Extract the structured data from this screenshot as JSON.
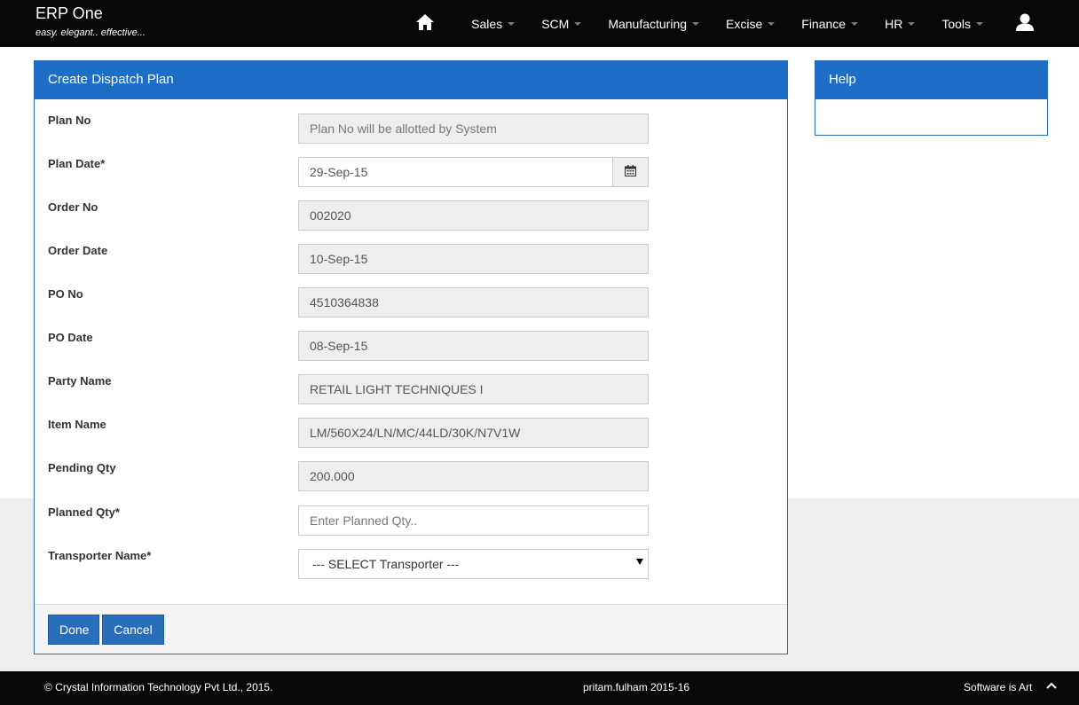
{
  "app": {
    "name": "ERP One",
    "tagline": "easy. elegant.. effective..."
  },
  "nav": {
    "items": [
      {
        "label": "Sales"
      },
      {
        "label": "SCM"
      },
      {
        "label": "Manufacturing"
      },
      {
        "label": "Excise"
      },
      {
        "label": "Finance"
      },
      {
        "label": "HR"
      },
      {
        "label": "Tools"
      }
    ],
    "icons": {
      "home": "home-icon",
      "user": "user-icon"
    }
  },
  "form": {
    "title": "Create Dispatch Plan",
    "fields": {
      "plan_no": {
        "label": "Plan No",
        "value": "",
        "placeholder": "Plan No will be allotted by System"
      },
      "plan_date": {
        "label": "Plan Date*",
        "value": "29-Sep-15"
      },
      "order_no": {
        "label": "Order No",
        "value": "002020"
      },
      "order_date": {
        "label": "Order Date",
        "value": "10-Sep-15"
      },
      "po_no": {
        "label": "PO No",
        "value": "4510364838"
      },
      "po_date": {
        "label": "PO Date",
        "value": "08-Sep-15"
      },
      "party_name": {
        "label": "Party Name",
        "value": "RETAIL LIGHT TECHNIQUES I"
      },
      "item_name": {
        "label": "Item Name",
        "value": "LM/560X24/LN/MC/44LD/30K/N7V1W"
      },
      "pending_qty": {
        "label": "Pending Qty",
        "value": "200.000"
      },
      "planned_qty": {
        "label": "Planned Qty*",
        "value": "",
        "placeholder": "Enter Planned Qty.."
      },
      "transporter": {
        "label": "Transporter Name*",
        "selected": "--- SELECT Transporter ---"
      }
    },
    "buttons": {
      "done": "Done",
      "cancel": "Cancel"
    }
  },
  "help": {
    "title": "Help"
  },
  "footer": {
    "copyright": "© Crystal Information Technology Pvt Ltd., 2015.",
    "user": "pritam.fulham 2015-16",
    "slogan": "Software is Art"
  },
  "colors": {
    "navbar": "#080808",
    "panel_heading": "#1e6ec8",
    "button": "#2a6ebb"
  }
}
